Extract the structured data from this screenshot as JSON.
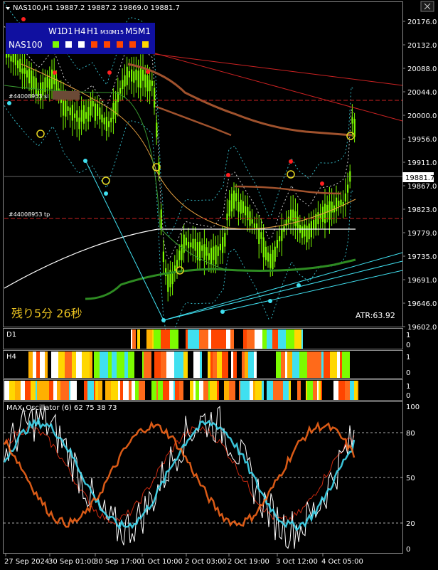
{
  "symbol_header": "NAS100,H1  19887.2 19887.2 19869.0 19881.7",
  "current_price": "19881.7",
  "timeframe_panel": {
    "row1": [
      "W1",
      "D1",
      "H4",
      "H1",
      "M30",
      "M15",
      "M5",
      "M1"
    ],
    "symbol": "NAS100",
    "swatch_colors": [
      "#7CFC00",
      "#ffffff",
      "#ffffff",
      "#ff4500",
      "#ff4500",
      "#ff4500",
      "#ff4500",
      "#ffd700"
    ]
  },
  "levels": {
    "level1": "#44008953 sl",
    "level2": "#44008953 tp"
  },
  "countdown": "残り5分 26秒",
  "atr": "ATR:63.92",
  "price_axis": [
    "20176.0",
    "20132.0",
    "20088.0",
    "20044.0",
    "20000.0",
    "19956.0",
    "19911.0",
    "19867.0",
    "19823.0",
    "19779.0",
    "19735.0",
    "19691.0",
    "19646.0",
    "19602.0"
  ],
  "panels": {
    "d1": {
      "label": "D1",
      "ticks": [
        "1",
        "0"
      ]
    },
    "h4": {
      "label": "H4",
      "ticks": [
        "1",
        "0"
      ]
    },
    "h1": {
      "label": "",
      "ticks": [
        "1",
        "0"
      ]
    }
  },
  "oscillator": {
    "title": "MAX_Oscillator (6) 62 75 38 73",
    "ticks": [
      "100",
      "80",
      "50",
      "20",
      "0"
    ]
  },
  "time_axis": [
    "27 Sep 2024",
    "30 Sep 01:00",
    "30 Sep 17:00",
    "1 Oct 10:00",
    "2 Oct 03:00",
    "2 Oct 19:00",
    "3 Oct 12:00",
    "4 Oct 05:00"
  ],
  "colors": {
    "bull_candle": "#7CFC00",
    "ma_brown": "#a0522d",
    "trend_red": "#cc2222",
    "support_cyan": "#40e0f0",
    "osc_cyan": "#40d8f0",
    "osc_orange": "#ff6a1a",
    "osc_red": "#cc2a10",
    "signal_yellow": "#e8d820"
  }
}
